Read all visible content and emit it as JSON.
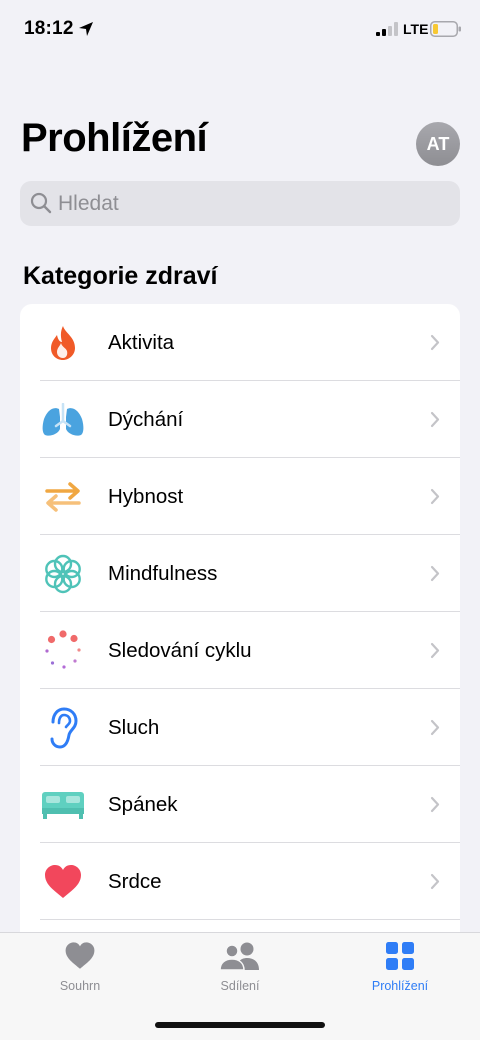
{
  "status": {
    "time": "18:12",
    "network": "LTE",
    "icons": [
      "location-arrow-icon",
      "signal-icon",
      "battery-icon"
    ]
  },
  "header": {
    "title": "Prohlížení",
    "avatar_initials": "AT"
  },
  "search": {
    "placeholder": "Hledat"
  },
  "section_title": "Kategorie zdraví",
  "categories": [
    {
      "label": "Aktivita",
      "icon": "flame-icon",
      "color": "#f05a28"
    },
    {
      "label": "Dýchání",
      "icon": "lungs-icon",
      "color": "#4aa3df"
    },
    {
      "label": "Hybnost",
      "icon": "arrows-icon",
      "color": "#f0a742"
    },
    {
      "label": "Mindfulness",
      "icon": "mindfulness-flower-icon",
      "color": "#4fc3b8"
    },
    {
      "label": "Sledování cyklu",
      "icon": "cycle-dots-icon",
      "color": "#f06a6a"
    },
    {
      "label": "Sluch",
      "icon": "ear-icon",
      "color": "#2f7df6"
    },
    {
      "label": "Spánek",
      "icon": "bed-icon",
      "color": "#5fd0c0"
    },
    {
      "label": "Srdce",
      "icon": "heart-icon",
      "color": "#f2475c"
    }
  ],
  "tabs": [
    {
      "label": "Souhrn",
      "icon": "heart-icon",
      "active": false
    },
    {
      "label": "Sdílení",
      "icon": "people-icon",
      "active": false
    },
    {
      "label": "Prohlížení",
      "icon": "grid-icon",
      "active": true
    }
  ],
  "colors": {
    "accent": "#2f7df6",
    "background": "#f2f2f7"
  }
}
